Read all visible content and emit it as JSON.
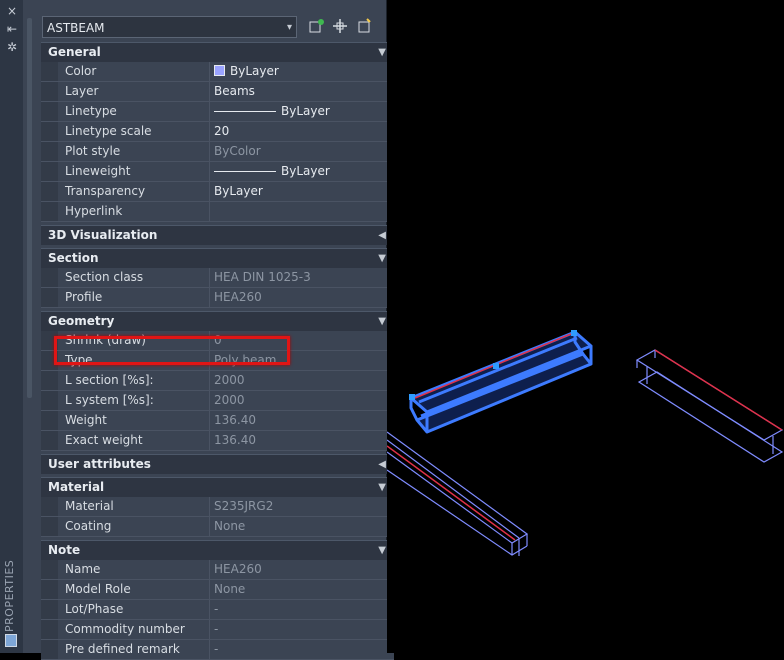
{
  "panel": {
    "title": "PROPERTIES",
    "object_type": "ASTBEAM"
  },
  "icons": {
    "close": "×",
    "pin": "⇤",
    "settings": "✲",
    "caret_down": "▾",
    "arrow_down": "▼",
    "arrow_left": "◀"
  },
  "sections": {
    "general": {
      "title": "General",
      "rows": {
        "color": {
          "label": "Color",
          "value": "ByLayer"
        },
        "layer": {
          "label": "Layer",
          "value": "Beams"
        },
        "linetype": {
          "label": "Linetype",
          "value": "ByLayer"
        },
        "linetype_scale": {
          "label": "Linetype scale",
          "value": "20"
        },
        "plot_style": {
          "label": "Plot style",
          "value": "ByColor"
        },
        "lineweight": {
          "label": "Lineweight",
          "value": "ByLayer"
        },
        "transparency": {
          "label": "Transparency",
          "value": "ByLayer"
        },
        "hyperlink": {
          "label": "Hyperlink",
          "value": ""
        }
      }
    },
    "visualization": {
      "title": "3D Visualization"
    },
    "section": {
      "title": "Section",
      "rows": {
        "section_class": {
          "label": "Section class",
          "value": "HEA DIN 1025-3"
        },
        "profile": {
          "label": "Profile",
          "value": "HEA260"
        }
      }
    },
    "geometry": {
      "title": "Geometry",
      "rows": {
        "shrink": {
          "label": "Shrink (draw)",
          "value": "0"
        },
        "type": {
          "label": "Type",
          "value": "Poly beam"
        },
        "l_section": {
          "label": "L section [%s]:",
          "value": "2000"
        },
        "l_system": {
          "label": "L system [%s]:",
          "value": "2000"
        },
        "weight": {
          "label": "Weight",
          "value": "136.40"
        },
        "exact_weight": {
          "label": "Exact weight",
          "value": "136.40"
        }
      }
    },
    "user_attributes": {
      "title": "User attributes"
    },
    "material": {
      "title": "Material",
      "rows": {
        "material": {
          "label": "Material",
          "value": "S235JRG2"
        },
        "coating": {
          "label": "Coating",
          "value": "None"
        }
      }
    },
    "note": {
      "title": "Note",
      "rows": {
        "name": {
          "label": "Name",
          "value": "HEA260"
        },
        "model_role": {
          "label": "Model Role",
          "value": "None"
        },
        "lot_phase": {
          "label": "Lot/Phase",
          "value": "-"
        },
        "commodity_number": {
          "label": "Commodity number",
          "value": "-"
        },
        "pre_defined_remark": {
          "label": "Pre defined remark",
          "value": "-"
        }
      }
    }
  },
  "colors": {
    "selected_beam": "#3d7bff",
    "beam_outline": "#7f8cff",
    "beam_edge_red": "#e0314a",
    "highlight_box": "#e01515"
  }
}
